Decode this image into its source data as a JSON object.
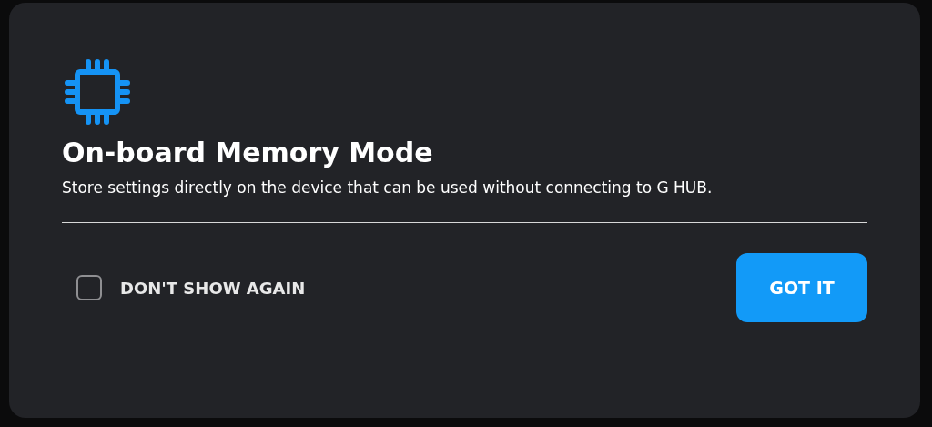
{
  "dialog": {
    "title": "On-board Memory Mode",
    "description": "Store settings directly on the device that can be used without connecting to G HUB.",
    "dont_show_again": {
      "label": "DON'T SHOW AGAIN",
      "checked": false
    },
    "buttons": [
      "GOT IT"
    ]
  }
}
